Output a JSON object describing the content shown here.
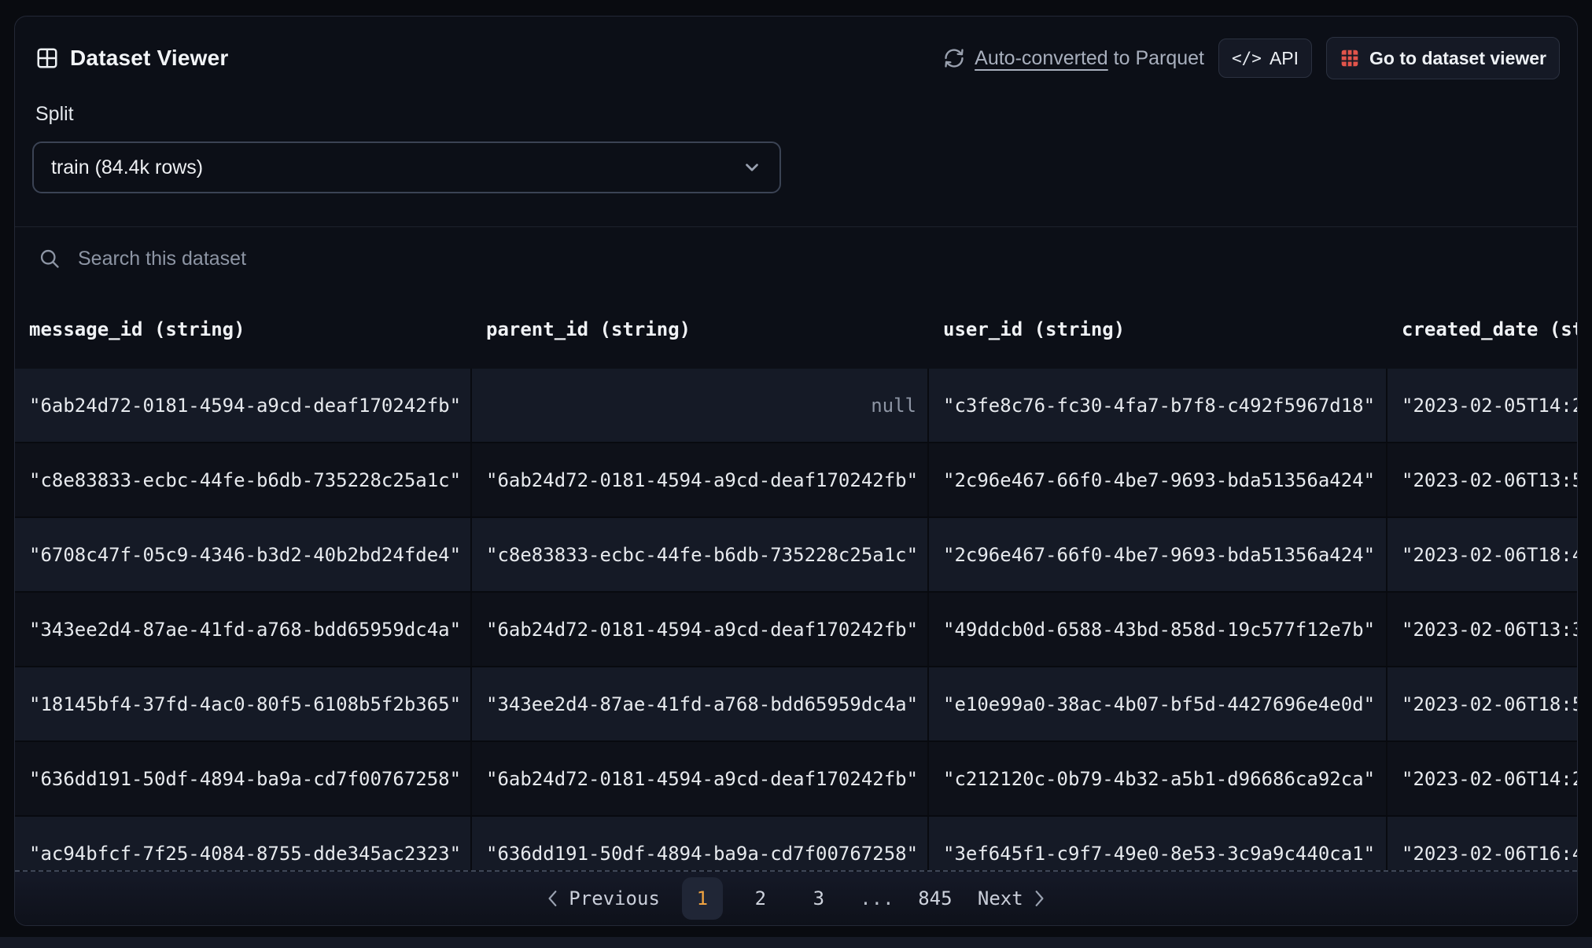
{
  "header": {
    "title": "Dataset Viewer",
    "auto_converted": "Auto-converted",
    "to_parquet": " to Parquet",
    "api_label": "API",
    "goto_label": "Go to dataset viewer"
  },
  "split": {
    "label": "Split",
    "selected": "train (84.4k rows)"
  },
  "search": {
    "placeholder": "Search this dataset"
  },
  "table": {
    "columns": [
      "message_id (string)",
      "parent_id (string)",
      "user_id (string)",
      "created_date (string)"
    ],
    "rows": [
      [
        "\"6ab24d72-0181-4594-a9cd-deaf170242fb\"",
        "null",
        "\"c3fe8c76-fc30-4fa7-b7f8-c492f5967d18\"",
        "\"2023-02-05T14:2"
      ],
      [
        "\"c8e83833-ecbc-44fe-b6db-735228c25a1c\"",
        "\"6ab24d72-0181-4594-a9cd-deaf170242fb\"",
        "\"2c96e467-66f0-4be7-9693-bda51356a424\"",
        "\"2023-02-06T13:5"
      ],
      [
        "\"6708c47f-05c9-4346-b3d2-40b2bd24fde4\"",
        "\"c8e83833-ecbc-44fe-b6db-735228c25a1c\"",
        "\"2c96e467-66f0-4be7-9693-bda51356a424\"",
        "\"2023-02-06T18:4"
      ],
      [
        "\"343ee2d4-87ae-41fd-a768-bdd65959dc4a\"",
        "\"6ab24d72-0181-4594-a9cd-deaf170242fb\"",
        "\"49ddcb0d-6588-43bd-858d-19c577f12e7b\"",
        "\"2023-02-06T13:3"
      ],
      [
        "\"18145bf4-37fd-4ac0-80f5-6108b5f2b365\"",
        "\"343ee2d4-87ae-41fd-a768-bdd65959dc4a\"",
        "\"e10e99a0-38ac-4b07-bf5d-4427696e4e0d\"",
        "\"2023-02-06T18:5"
      ],
      [
        "\"636dd191-50df-4894-ba9a-cd7f00767258\"",
        "\"6ab24d72-0181-4594-a9cd-deaf170242fb\"",
        "\"c212120c-0b79-4b32-a5b1-d96686ca92ca\"",
        "\"2023-02-06T14:2"
      ],
      [
        "\"ac94bfcf-7f25-4084-8755-dde345ac2323\"",
        "\"636dd191-50df-4894-ba9a-cd7f00767258\"",
        "\"3ef645f1-c9f7-49e0-8e53-3c9a9c440ca1\"",
        "\"2023-02-06T16:4"
      ]
    ]
  },
  "pagination": {
    "previous": "Previous",
    "pages": [
      "1",
      "2",
      "3",
      "...",
      "845"
    ],
    "current": "1",
    "next": "Next"
  },
  "colors": {
    "accent": "#f0a341",
    "grid_icon_red": "#e2544b",
    "row_odd": "#151a26",
    "row_even": "#0e1119"
  }
}
